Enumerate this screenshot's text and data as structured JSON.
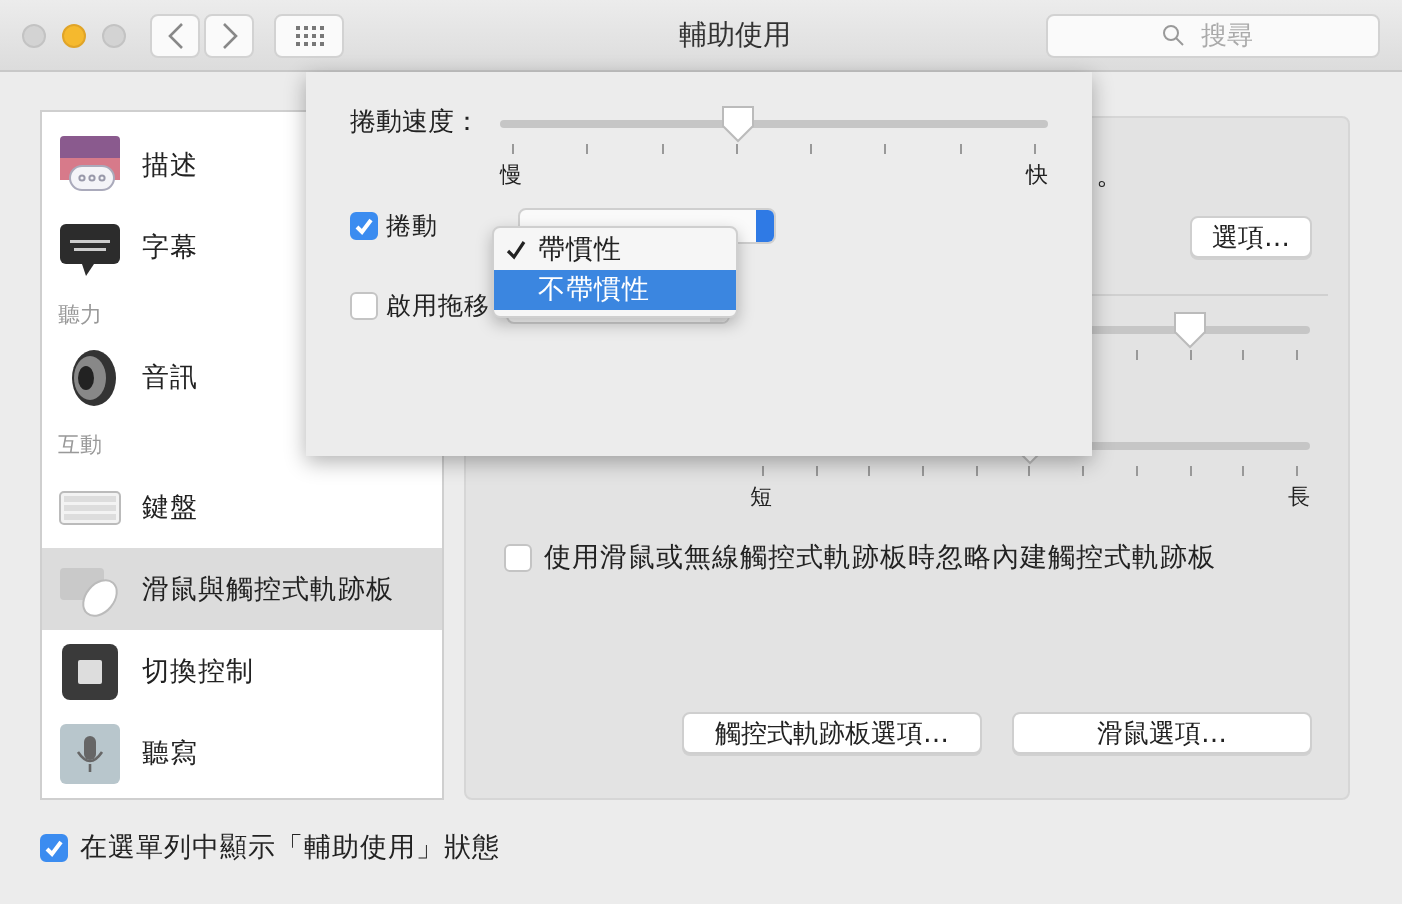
{
  "window": {
    "title": "輔助使用"
  },
  "toolbar": {
    "search": {
      "placeholder": "搜尋"
    }
  },
  "sidebar": {
    "items": [
      {
        "kind": "item",
        "label": "描述",
        "selected": false
      },
      {
        "kind": "item",
        "label": "字幕",
        "selected": false
      },
      {
        "kind": "header",
        "label": "聽力",
        "selected": false
      },
      {
        "kind": "item",
        "label": "音訊",
        "selected": false
      },
      {
        "kind": "header",
        "label": "互動",
        "selected": false
      },
      {
        "kind": "item",
        "label": "鍵盤",
        "selected": false
      },
      {
        "kind": "item",
        "label": "滑鼠與觸控式軌跡板",
        "selected": true
      },
      {
        "kind": "item",
        "label": "切換控制",
        "selected": false
      },
      {
        "kind": "item",
        "label": "聽寫",
        "selected": false
      }
    ]
  },
  "panel": {
    "note_fragment": "。",
    "options_button": "選項…",
    "slider_1": {
      "level": 0.8
    },
    "slider_2": {
      "level": 0.5,
      "min_label": "短",
      "max_label": "長"
    },
    "ignore_trackpad": {
      "label": "使用滑鼠或無線觸控式軌跡板時忽略內建觸控式軌跡板",
      "checked": false
    },
    "buttons": [
      "觸控式軌跡板選項…",
      "滑鼠選項…"
    ]
  },
  "sheet": {
    "speed_slider": {
      "label": "捲動速度：",
      "level": 0.43,
      "min_label": "慢",
      "max_label": "快"
    },
    "options": [
      {
        "label": "捲動",
        "checked": true
      },
      {
        "label": "啟用拖移",
        "checked": false
      }
    ],
    "menu": {
      "items": [
        {
          "label": "帶慣性",
          "checked": true,
          "selected": false
        },
        {
          "label": "不帶慣性",
          "checked": false,
          "selected": true
        }
      ]
    }
  },
  "footer": {
    "show_in_menu_bar": {
      "label": "在選單列中顯示「輔助使用」狀態",
      "checked": true
    }
  }
}
